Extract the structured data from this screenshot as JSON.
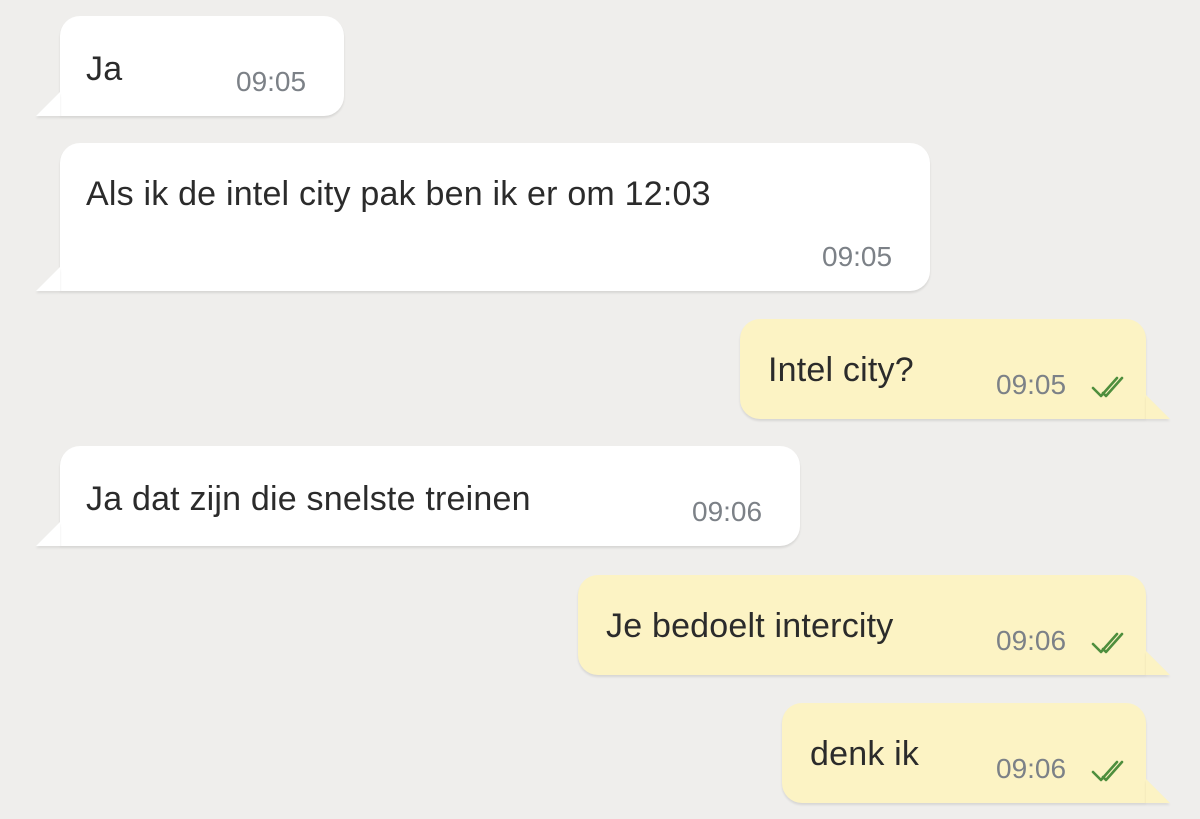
{
  "colors": {
    "background": "#efeeec",
    "incoming_bubble": "#ffffff",
    "outgoing_bubble": "#fcf3c4",
    "text": "#2b2b2b",
    "timestamp": "#7c8187",
    "read_ticks": "#4e8e3d"
  },
  "messages": [
    {
      "direction": "incoming",
      "text": "Ja",
      "time": "09:05"
    },
    {
      "direction": "incoming",
      "text": "Als ik de intel city pak ben ik er om 12:03",
      "time": "09:05"
    },
    {
      "direction": "outgoing",
      "text": "Intel city?",
      "time": "09:05",
      "status_icon": "double-check-icon"
    },
    {
      "direction": "incoming",
      "text": "Ja dat zijn die snelste treinen",
      "time": "09:06"
    },
    {
      "direction": "outgoing",
      "text": "Je bedoelt intercity",
      "time": "09:06",
      "status_icon": "double-check-icon"
    },
    {
      "direction": "outgoing",
      "text": "denk ik",
      "time": "09:06",
      "status_icon": "double-check-icon"
    }
  ]
}
